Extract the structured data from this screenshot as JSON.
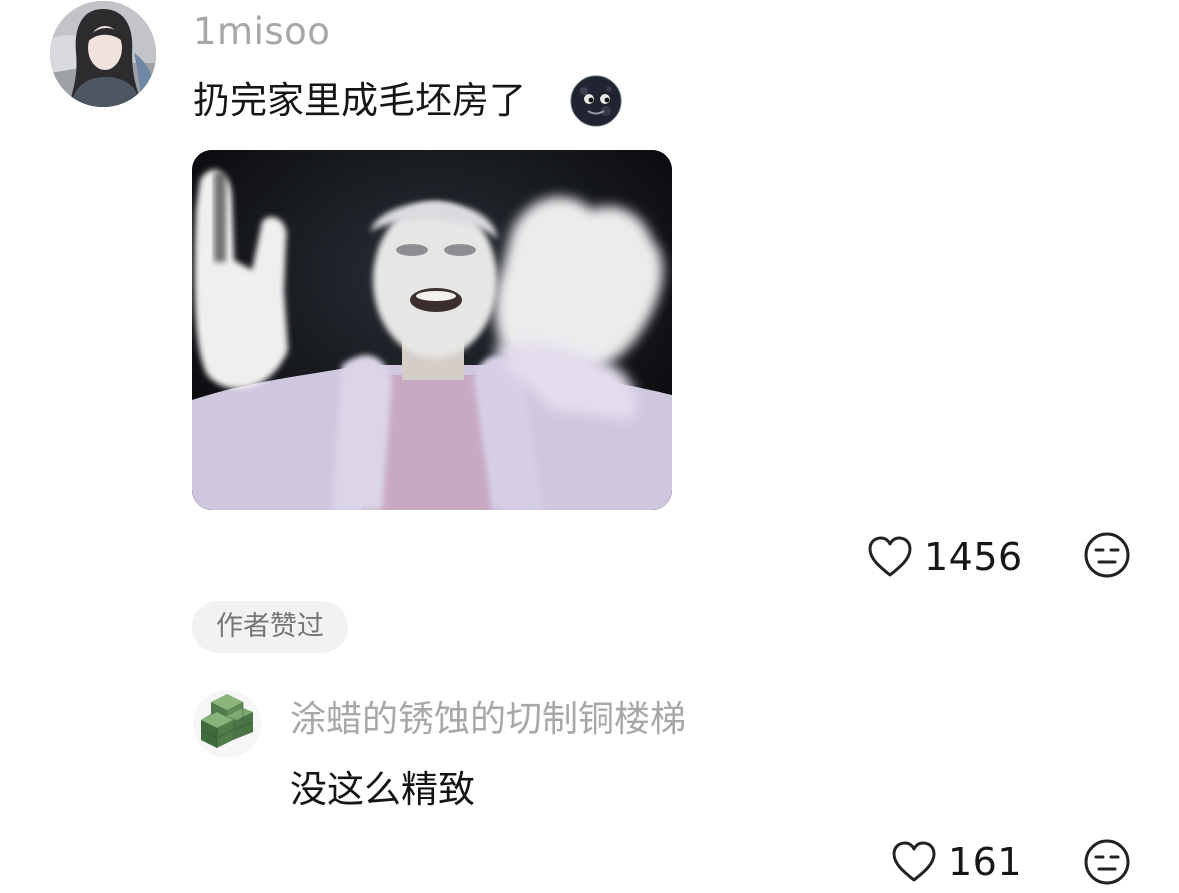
{
  "main_comment": {
    "username": "1misoo",
    "text": "扔完家里成毛坯房了",
    "emoji_icon": "new-moon-face-icon",
    "image_alt": "meme-person-waving-hands",
    "like_count": "1456",
    "liked_by_author_badge": "作者赞过"
  },
  "reply": {
    "username": "涂蜡的锈蚀的切制铜楼梯",
    "text": "没这么精致",
    "like_count": "161"
  },
  "icons": {
    "like": "heart-outline-icon",
    "dislike": "neutral-face-icon"
  },
  "colors": {
    "username_gray": "#a7a7a7",
    "text": "#151515",
    "badge_bg": "#f2f2f2",
    "badge_text": "#767676"
  }
}
